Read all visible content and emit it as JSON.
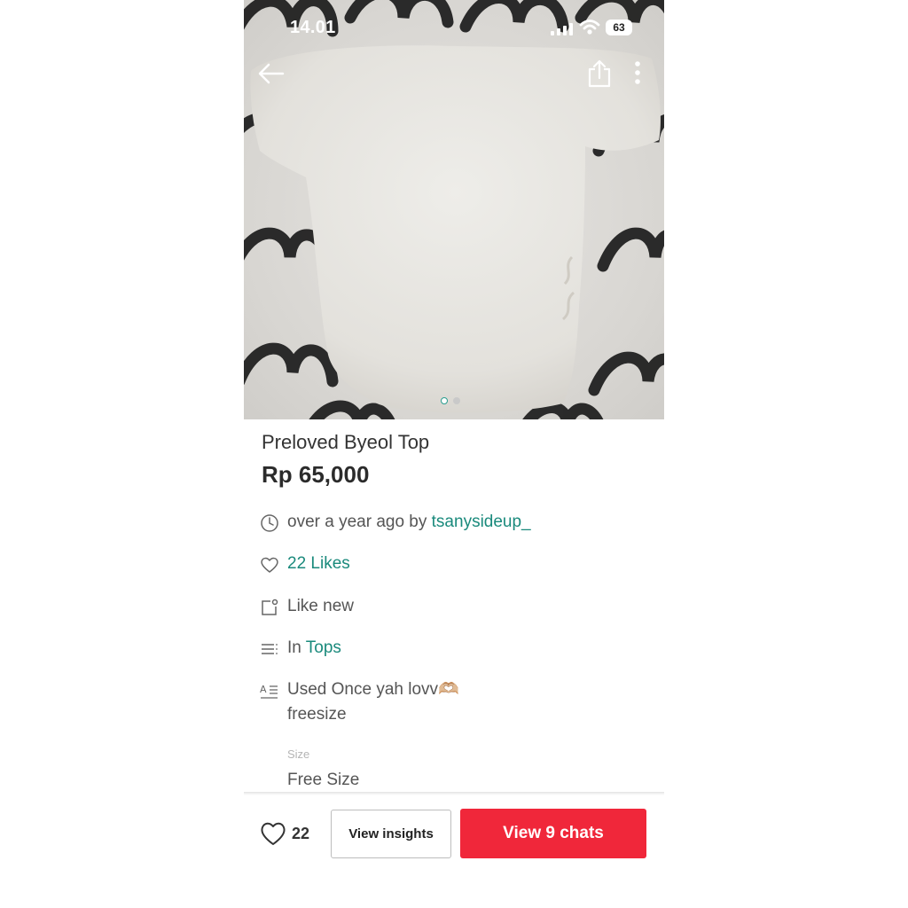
{
  "status_bar": {
    "time": "14.01",
    "battery": "63"
  },
  "product": {
    "title": "Preloved Byeol Top",
    "price": "Rp 65,000"
  },
  "meta": {
    "posted_prefix": "over a year ago by",
    "seller": "tsanysideup_",
    "likes_text": "22 Likes",
    "condition": "Like new",
    "category_prefix": "In",
    "category": "Tops",
    "description_line1": "Used Once yah lovv🫶🏼",
    "description_line2": "freesize",
    "size_label": "Size",
    "size_value": "Free Size"
  },
  "image_carousel": {
    "count": 2,
    "active": 1
  },
  "bottom_bar": {
    "like_count": "22",
    "insights_label": "View insights",
    "chats_label": "View 9 chats"
  },
  "colors": {
    "accent": "#1a8a7c",
    "primary_button": "#f0273a"
  },
  "icons": [
    "back-arrow-icon",
    "share-icon",
    "more-vertical-icon",
    "clock-icon",
    "heart-icon",
    "condition-tag-icon",
    "list-icon",
    "description-icon",
    "signal-icon",
    "wifi-icon",
    "battery-icon"
  ]
}
